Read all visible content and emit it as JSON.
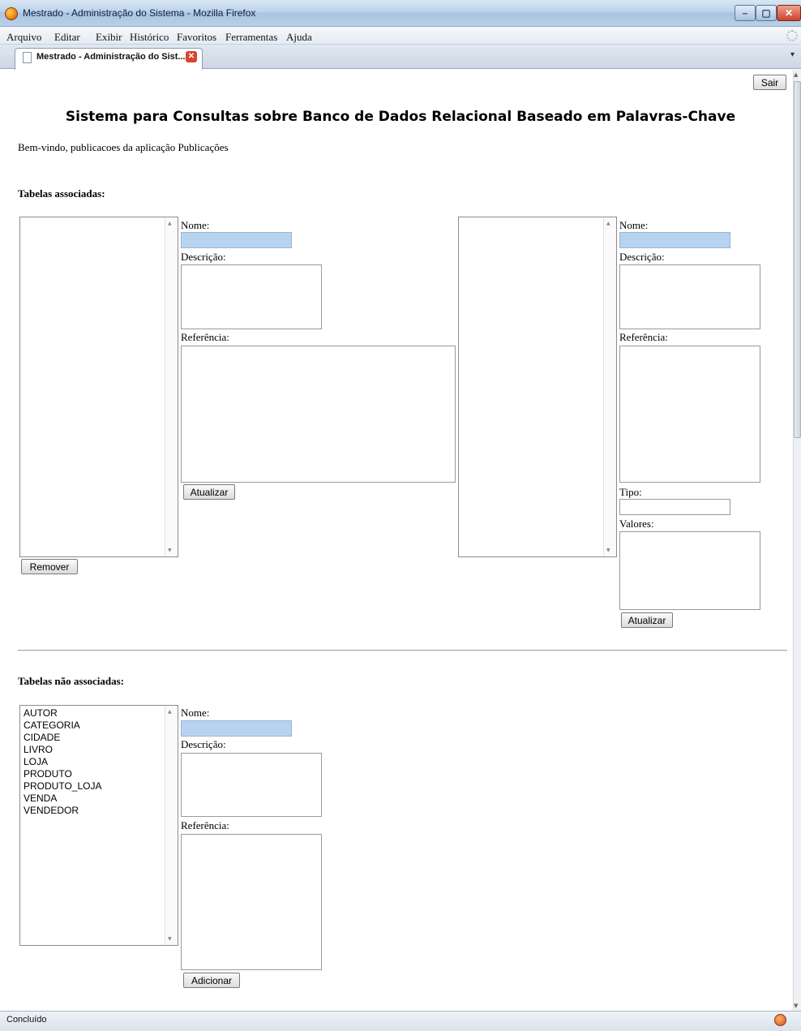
{
  "window": {
    "title": "Mestrado - Administração do Sistema - Mozilla Firefox",
    "min_glyph": "–",
    "max_glyph": "▢",
    "close_glyph": "✕"
  },
  "menu": [
    "Arquivo",
    "Editar",
    "Exibir",
    "Histórico",
    "Favoritos",
    "Ferramentas",
    "Ajuda"
  ],
  "tab": {
    "label": "Mestrado - Administração do Sist...",
    "close_glyph": "✕",
    "dropdown_glyph": "▾"
  },
  "page": {
    "logout_label": "Sair",
    "title": "Sistema para Consultas sobre Banco de Dados Relacional Baseado em Palavras-Chave",
    "welcome": "Bem-vindo, publicacoes da aplicação Publicações"
  },
  "associated": {
    "heading": "Tabelas associadas:",
    "remove_label": "Remover",
    "name_label": "Nome:",
    "description_label": "Descrição:",
    "reference_label": "Referência:",
    "update_label": "Atualizar",
    "column_panel": {
      "name_label": "Nome:",
      "description_label": "Descrição:",
      "reference_label": "Referência:",
      "type_label": "Tipo:",
      "values_label": "Valores:",
      "update_label": "Atualizar"
    }
  },
  "unassociated": {
    "heading": "Tabelas não associadas:",
    "tables": [
      "AUTOR",
      "CATEGORIA",
      "CIDADE",
      "LIVRO",
      "LOJA",
      "PRODUTO",
      "PRODUTO_LOJA",
      "VENDA",
      "VENDEDOR"
    ],
    "name_label": "Nome:",
    "description_label": "Descrição:",
    "reference_label": "Referência:",
    "add_label": "Adicionar"
  },
  "status": {
    "text": "Concluído"
  },
  "icons": {
    "app": "firefox-icon",
    "tab": "document-icon",
    "addon": "addon-status-icon"
  }
}
